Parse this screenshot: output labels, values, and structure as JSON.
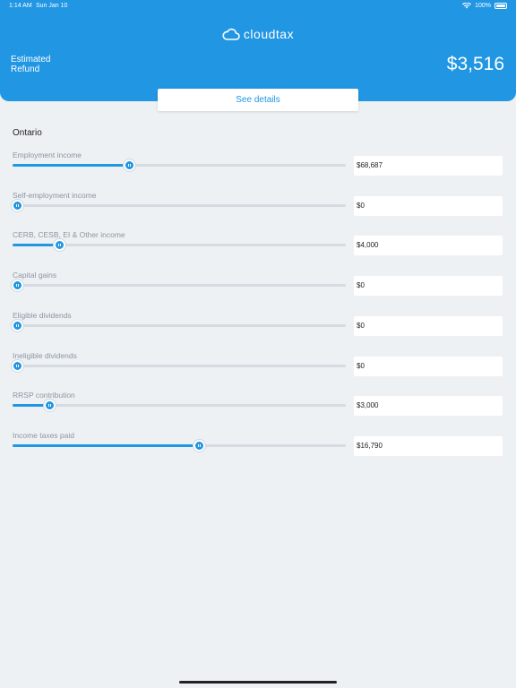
{
  "status": {
    "time": "1:14 AM",
    "date": "Sun Jan 10",
    "battery": "100%"
  },
  "brand": {
    "name": "cloudtax",
    "icon": "cloud-icon",
    "color": "#2196e3"
  },
  "summary": {
    "label_line1": "Estimated",
    "label_line2": "Refund",
    "amount": "$3,516"
  },
  "details_button": "See details",
  "province": "Ontario",
  "fields": [
    {
      "label": "Employment income",
      "value": "$68,687",
      "slider_fraction": 0.35
    },
    {
      "label": "Self-employment income",
      "value": "$0",
      "slider_fraction": 0.0
    },
    {
      "label": "CERB, CESB, EI & Other income",
      "value": "$4,000",
      "slider_fraction": 0.14
    },
    {
      "label": "Capital gains",
      "value": "$0",
      "slider_fraction": 0.0
    },
    {
      "label": "Eligible dividends",
      "value": "$0",
      "slider_fraction": 0.0
    },
    {
      "label": "Ineligible dividends",
      "value": "$0",
      "slider_fraction": 0.0
    },
    {
      "label": "RRSP contribution",
      "value": "$3,000",
      "slider_fraction": 0.11
    },
    {
      "label": "Income taxes paid",
      "value": "$16,790",
      "slider_fraction": 0.56
    }
  ]
}
